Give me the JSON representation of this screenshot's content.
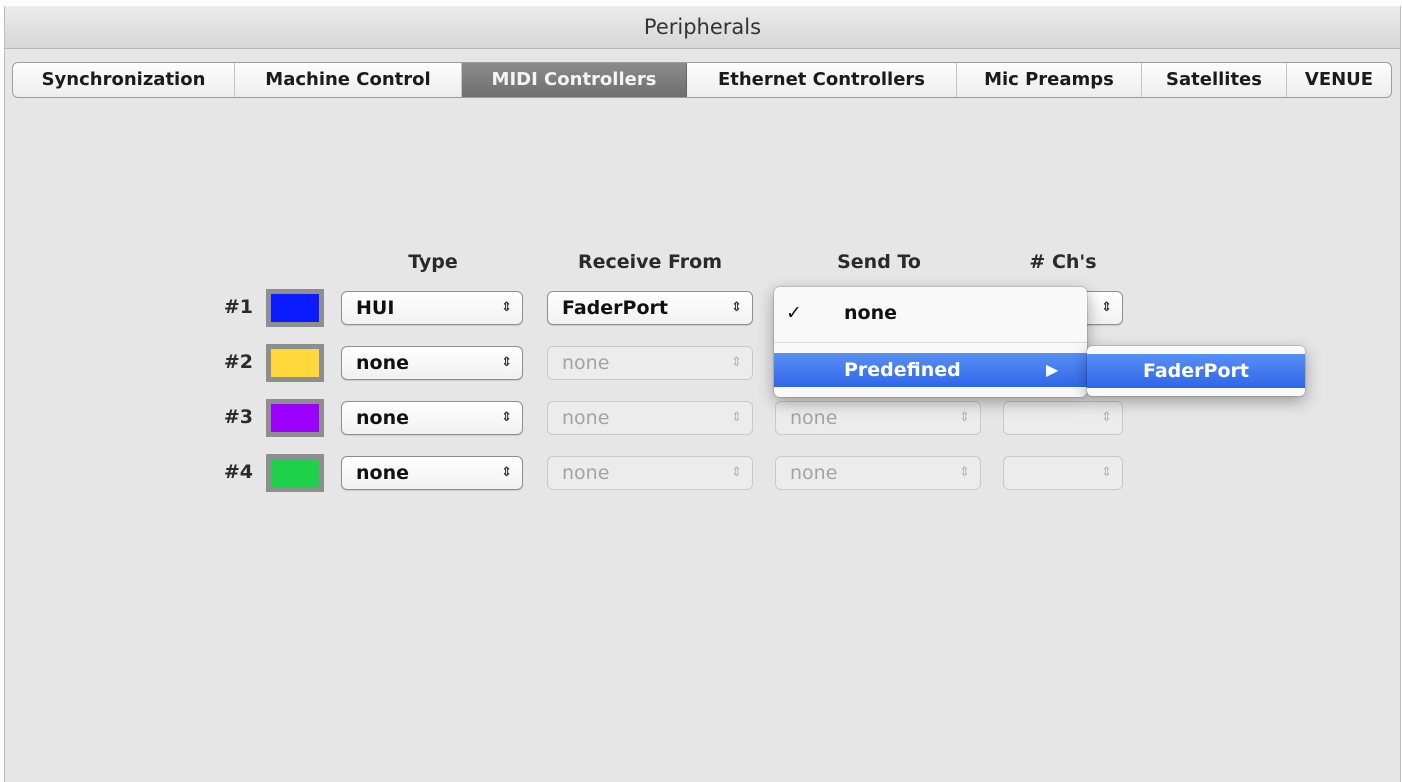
{
  "window": {
    "title": "Peripherals"
  },
  "tabs": [
    {
      "label": "Synchronization"
    },
    {
      "label": "Machine Control"
    },
    {
      "label": "MIDI Controllers",
      "active": true
    },
    {
      "label": "Ethernet Controllers"
    },
    {
      "label": "Mic Preamps"
    },
    {
      "label": "Satellites"
    },
    {
      "label": "VENUE"
    }
  ],
  "columns": {
    "type": "Type",
    "receive": "Receive From",
    "send": "Send To",
    "channels": "# Ch's"
  },
  "rows": [
    {
      "label": "#1",
      "color": "#0a1cff",
      "type": "HUI",
      "receive": "FaderPort",
      "send": "",
      "channels": ""
    },
    {
      "label": "#2",
      "color": "#ffd83b",
      "type": "none",
      "receive": "none",
      "send": "",
      "channels": ""
    },
    {
      "label": "#3",
      "color": "#9b00ff",
      "type": "none",
      "receive": "none",
      "send": "none",
      "channels": ""
    },
    {
      "label": "#4",
      "color": "#1fd14a",
      "type": "none",
      "receive": "none",
      "send": "none",
      "channels": ""
    }
  ],
  "menu": {
    "checkmark": "✓",
    "items": [
      {
        "label": "none",
        "checked": true
      },
      {
        "label": "Predefined",
        "submenu_arrow": "▶"
      }
    ],
    "submenu": {
      "items": [
        {
          "label": "FaderPort"
        }
      ]
    }
  },
  "icons": {
    "popup_arrows": "updown-arrows-icon",
    "check": "checkmark-icon",
    "submenu": "submenu-arrow-icon"
  },
  "colors": {
    "highlight": "#2f66e8",
    "active_tab": "#7d7d7d"
  }
}
